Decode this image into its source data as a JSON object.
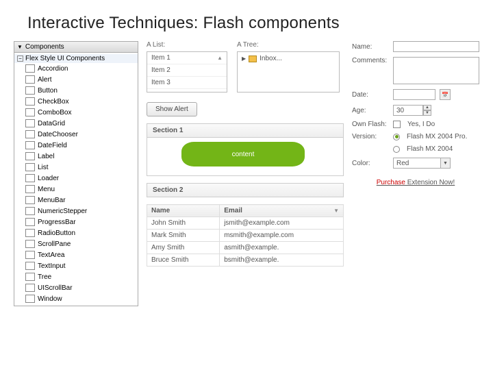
{
  "title": "Interactive Techniques: Flash components",
  "panel": {
    "title": "Components",
    "root": "Flex Style UI Components",
    "items": [
      "Accordion",
      "Alert",
      "Button",
      "CheckBox",
      "ComboBox",
      "DataGrid",
      "DateChooser",
      "DateField",
      "Label",
      "List",
      "Loader",
      "Menu",
      "MenuBar",
      "NumericStepper",
      "ProgressBar",
      "RadioButton",
      "ScrollPane",
      "TextArea",
      "TextInput",
      "Tree",
      "UIScrollBar",
      "Window"
    ]
  },
  "mid": {
    "list_label": "A List:",
    "list_items": [
      "Item 1",
      "Item 2",
      "Item 3"
    ],
    "tree_label": "A Tree:",
    "tree_root": "Inbox...",
    "alert_btn": "Show Alert",
    "section1": "Section 1",
    "content_text": "content",
    "section2": "Section 2",
    "grid_headers": [
      "Name",
      "Email"
    ],
    "grid_rows": [
      [
        "John Smith",
        "jsmith@example.com"
      ],
      [
        "Mark Smith",
        "msmith@example.com"
      ],
      [
        "Amy Smith",
        "asmith@example."
      ],
      [
        "Bruce Smith",
        "bsmith@example."
      ]
    ]
  },
  "form": {
    "name_lbl": "Name:",
    "comments_lbl": "Comments:",
    "date_lbl": "Date:",
    "age_lbl": "Age:",
    "age_val": "30",
    "own_lbl": "Own Flash:",
    "own_chk": "Yes, I Do",
    "version_lbl": "Version:",
    "ver1": "Flash MX 2004 Pro.",
    "ver2": "Flash MX 2004",
    "color_lbl": "Color:",
    "color_val": "Red",
    "purchase_red": "Purchase",
    "purchase_rest": " Extension Now!"
  }
}
